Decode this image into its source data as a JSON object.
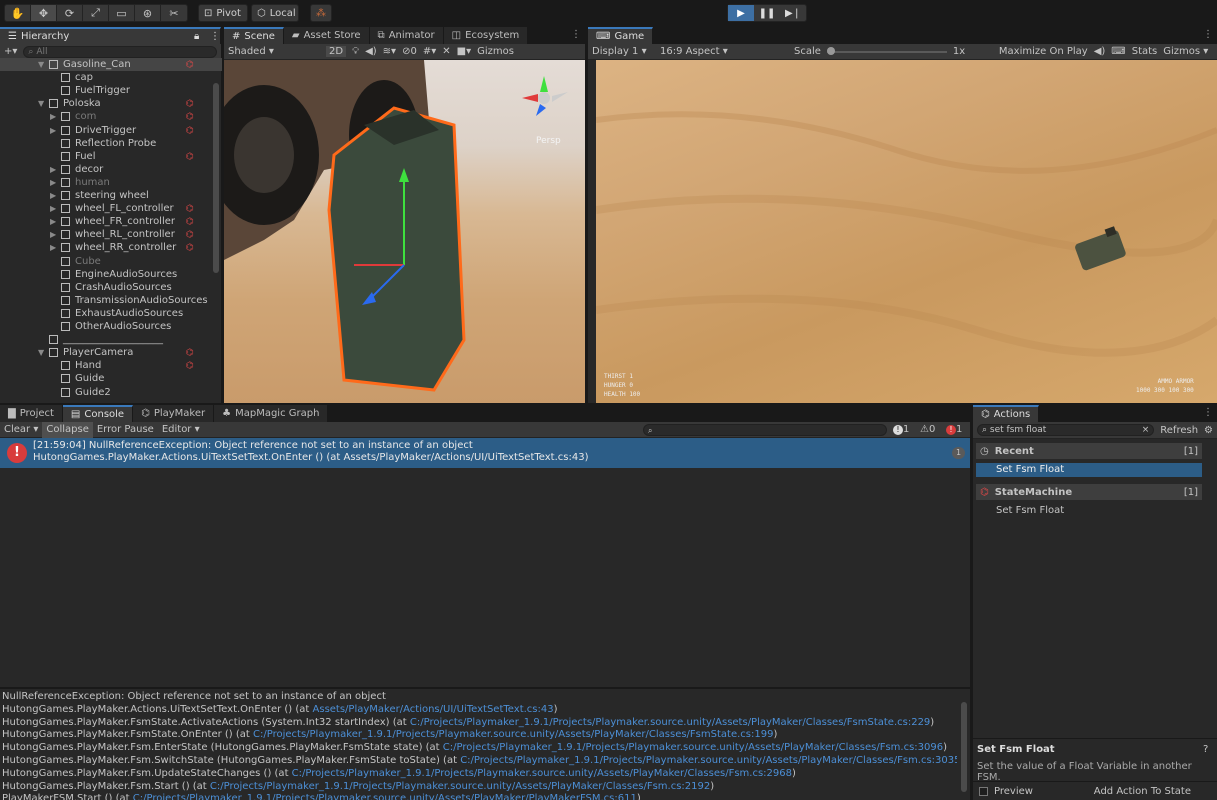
{
  "toolbar": {
    "pivot_label": "Pivot",
    "local_label": "Local"
  },
  "hierarchy": {
    "tab": "Hierarchy",
    "search_placeholder": "All",
    "items": [
      {
        "label": "Gasoline_Can",
        "indent": 1,
        "arrow": "▼",
        "pm": true,
        "selected": true,
        "dim": false
      },
      {
        "label": "cap",
        "indent": 2,
        "arrow": "",
        "pm": false,
        "selected": false,
        "dim": false
      },
      {
        "label": "FuelTrigger",
        "indent": 2,
        "arrow": "",
        "pm": false,
        "selected": false,
        "dim": false
      },
      {
        "label": "Poloska",
        "indent": 1,
        "arrow": "▼",
        "pm": true,
        "selected": false,
        "dim": false
      },
      {
        "label": "com",
        "indent": 2,
        "arrow": "▶",
        "pm": true,
        "selected": false,
        "dim": true
      },
      {
        "label": "DriveTrigger",
        "indent": 2,
        "arrow": "▶",
        "pm": true,
        "selected": false,
        "dim": false
      },
      {
        "label": "Reflection Probe",
        "indent": 2,
        "arrow": "",
        "pm": false,
        "selected": false,
        "dim": false
      },
      {
        "label": "Fuel",
        "indent": 2,
        "arrow": "",
        "pm": true,
        "selected": false,
        "dim": false
      },
      {
        "label": "decor",
        "indent": 2,
        "arrow": "▶",
        "pm": false,
        "selected": false,
        "dim": false
      },
      {
        "label": "human",
        "indent": 2,
        "arrow": "▶",
        "pm": false,
        "selected": false,
        "dim": true
      },
      {
        "label": "steering wheel",
        "indent": 2,
        "arrow": "▶",
        "pm": false,
        "selected": false,
        "dim": false
      },
      {
        "label": "wheel_FL_controller",
        "indent": 2,
        "arrow": "▶",
        "pm": true,
        "selected": false,
        "dim": false
      },
      {
        "label": "wheel_FR_controller",
        "indent": 2,
        "arrow": "▶",
        "pm": true,
        "selected": false,
        "dim": false
      },
      {
        "label": "wheel_RL_controller",
        "indent": 2,
        "arrow": "▶",
        "pm": true,
        "selected": false,
        "dim": false
      },
      {
        "label": "wheel_RR_controller",
        "indent": 2,
        "arrow": "▶",
        "pm": true,
        "selected": false,
        "dim": false
      },
      {
        "label": "Cube",
        "indent": 2,
        "arrow": "",
        "pm": false,
        "selected": false,
        "dim": true
      },
      {
        "label": "EngineAudioSources",
        "indent": 2,
        "arrow": "",
        "pm": false,
        "selected": false,
        "dim": false
      },
      {
        "label": "CrashAudioSources",
        "indent": 2,
        "arrow": "",
        "pm": false,
        "selected": false,
        "dim": false
      },
      {
        "label": "TransmissionAudioSources",
        "indent": 2,
        "arrow": "",
        "pm": false,
        "selected": false,
        "dim": false
      },
      {
        "label": "ExhaustAudioSources",
        "indent": 2,
        "arrow": "",
        "pm": false,
        "selected": false,
        "dim": false
      },
      {
        "label": "OtherAudioSources",
        "indent": 2,
        "arrow": "",
        "pm": false,
        "selected": false,
        "dim": false
      },
      {
        "label": "____________________",
        "indent": 1,
        "arrow": "",
        "pm": false,
        "selected": false,
        "dim": false
      },
      {
        "label": "PlayerCamera",
        "indent": 1,
        "arrow": "▼",
        "pm": true,
        "selected": false,
        "dim": false
      },
      {
        "label": "Hand",
        "indent": 2,
        "arrow": "",
        "pm": true,
        "selected": false,
        "dim": false
      },
      {
        "label": "Guide",
        "indent": 2,
        "arrow": "",
        "pm": false,
        "selected": false,
        "dim": false
      },
      {
        "label": "Guide2",
        "indent": 2,
        "arrow": "",
        "pm": false,
        "selected": false,
        "dim": false
      }
    ]
  },
  "scene": {
    "tabs": [
      "Scene",
      "Asset Store",
      "Animator",
      "Ecosystem"
    ],
    "shading": "Shaded",
    "mode_2d": "2D",
    "hidden_count": "0",
    "gizmos": "Gizmos",
    "persp": "Persp"
  },
  "game": {
    "tab": "Game",
    "display": "Display 1",
    "aspect": "16:9 Aspect",
    "scale_label": "Scale",
    "scale_value": "1x",
    "maximize": "Maximize On Play",
    "stats": "Stats",
    "gizmos": "Gizmos",
    "hud_left": [
      "THIRST",
      "HUNGER",
      "HEALTH"
    ],
    "hud_left_vals": [
      "1",
      "0",
      "100"
    ],
    "hud_right_labels": [
      "AMMO",
      "ARMOR"
    ],
    "hud_right_vals": "1000  300  100  300"
  },
  "console": {
    "tabs": [
      "Project",
      "Console",
      "PlayMaker",
      "MapMagic Graph"
    ],
    "clear": "Clear",
    "collapse": "Collapse",
    "error_pause": "Error Pause",
    "editor": "Editor",
    "count_info": "1",
    "count_warn": "0",
    "count_err": "1",
    "entry_line1": "[21:59:04] NullReferenceException: Object reference not set to an instance of an object",
    "entry_line2": "HutongGames.PlayMaker.Actions.UiTextSetText.OnEnter () (at Assets/PlayMaker/Actions/UI/UiTextSetText.cs:43)",
    "entry_count": "1",
    "stack": [
      {
        "text": "NullReferenceException: Object reference not set to an instance of an object",
        "link": ""
      },
      {
        "text": "HutongGames.PlayMaker.Actions.UiTextSetText.OnEnter () (at ",
        "link": "Assets/PlayMaker/Actions/UI/UiTextSetText.cs:43",
        "tail": ")"
      },
      {
        "text": "HutongGames.PlayMaker.FsmState.ActivateActions (System.Int32 startIndex) (at ",
        "link": "C:/Projects/Playmaker_1.9.1/Projects/Playmaker.source.unity/Assets/PlayMaker/Classes/FsmState.cs:229",
        "tail": ")"
      },
      {
        "text": "HutongGames.PlayMaker.FsmState.OnEnter () (at ",
        "link": "C:/Projects/Playmaker_1.9.1/Projects/Playmaker.source.unity/Assets/PlayMaker/Classes/FsmState.cs:199",
        "tail": ")"
      },
      {
        "text": "HutongGames.PlayMaker.Fsm.EnterState (HutongGames.PlayMaker.FsmState state) (at ",
        "link": "C:/Projects/Playmaker_1.9.1/Projects/Playmaker.source.unity/Assets/PlayMaker/Classes/Fsm.cs:3096",
        "tail": ")"
      },
      {
        "text": "HutongGames.PlayMaker.Fsm.SwitchState (HutongGames.PlayMaker.FsmState toState) (at ",
        "link": "C:/Projects/Playmaker_1.9.1/Projects/Playmaker.source.unity/Assets/PlayMaker/Classes/Fsm.cs:3035",
        "tail": ")"
      },
      {
        "text": "HutongGames.PlayMaker.Fsm.UpdateStateChanges () (at ",
        "link": "C:/Projects/Playmaker_1.9.1/Projects/Playmaker.source.unity/Assets/PlayMaker/Classes/Fsm.cs:2968",
        "tail": ")"
      },
      {
        "text": "HutongGames.PlayMaker.Fsm.Start () (at ",
        "link": "C:/Projects/Playmaker_1.9.1/Projects/Playmaker.source.unity/Assets/PlayMaker/Classes/Fsm.cs:2192",
        "tail": ")"
      },
      {
        "text": "PlayMakerFSM.Start () (at ",
        "link": "C:/Projects/Playmaker_1.9.1/Projects/Playmaker.source.unity/Assets/PlayMaker/PlayMakerFSM.cs:611",
        "tail": ")"
      }
    ]
  },
  "actions": {
    "tab": "Actions",
    "search_value": "set fsm float",
    "refresh": "Refresh",
    "recent_label": "Recent",
    "recent_count": "[1]",
    "recent_item": "Set Fsm Float",
    "statemachine_label": "StateMachine",
    "statemachine_count": "[1]",
    "statemachine_item": "Set Fsm Float",
    "desc_title": "Set Fsm Float",
    "desc_text": "Set the value of a Float Variable in another FSM.",
    "preview": "Preview",
    "add_action": "Add Action To State"
  }
}
